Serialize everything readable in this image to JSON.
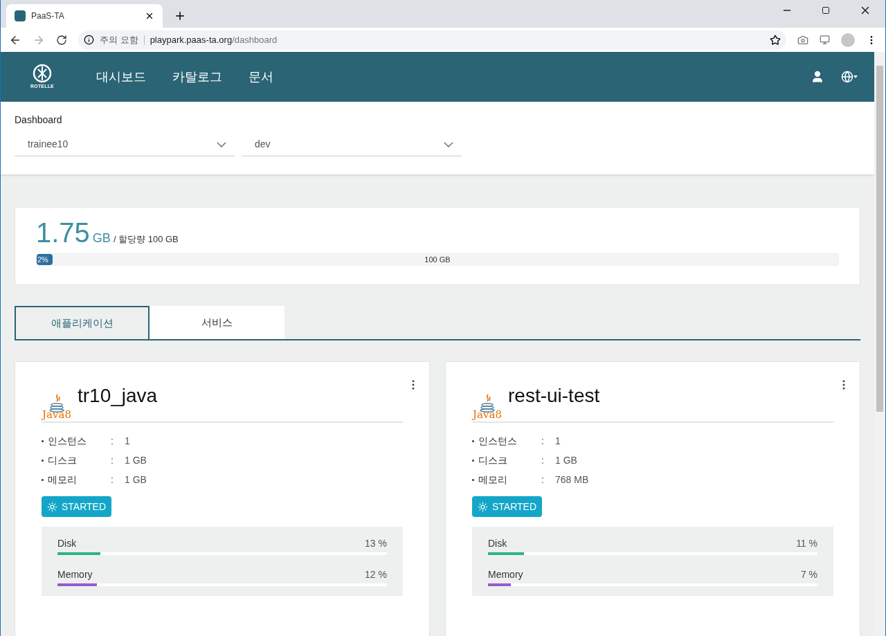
{
  "browser": {
    "tab_title": "PaaS-TA",
    "security_label": "주의 요함",
    "url_host": "playpark.paas-ta.org",
    "url_path": "/dashboard"
  },
  "header": {
    "logo_text": "ROTELLE",
    "nav": [
      {
        "label": "대시보드"
      },
      {
        "label": "카탈로그"
      },
      {
        "label": "문서"
      }
    ]
  },
  "dashboard": {
    "title": "Dashboard",
    "selects": [
      {
        "value": "trainee10"
      },
      {
        "value": "dev"
      }
    ]
  },
  "quota": {
    "used": "1.75",
    "unit": "GB",
    "allocation": "/ 할당량 100 GB",
    "level": 0.02,
    "percent": "2%",
    "total": "100 GB"
  },
  "tabs": [
    {
      "label": "애플리케이션",
      "selected": true
    },
    {
      "label": "서비스",
      "selected": false
    }
  ],
  "apps": [
    {
      "runtime": "Java8",
      "name": "tr10_java",
      "details": [
        {
          "label": "인스턴스",
          "separator": ":",
          "value": "1"
        },
        {
          "label": "디스크",
          "separator": ":",
          "value": "1 GB"
        },
        {
          "label": "메모리",
          "separator": ":",
          "value": "1 GB"
        }
      ],
      "status": "STARTED",
      "usage": [
        {
          "kind": "disk",
          "label": "Disk",
          "reading": "13 %",
          "level": 0.13
        },
        {
          "kind": "memory",
          "label": "Memory",
          "reading": "12 %",
          "level": 0.12
        }
      ]
    },
    {
      "runtime": "Java8",
      "name": "rest-ui-test",
      "details": [
        {
          "label": "인스턴스",
          "separator": ":",
          "value": "1"
        },
        {
          "label": "디스크",
          "separator": ":",
          "value": "1 GB"
        },
        {
          "label": "메모리",
          "separator": ":",
          "value": "768 MB"
        }
      ],
      "status": "STARTED",
      "usage": [
        {
          "kind": "disk",
          "label": "Disk",
          "reading": "11 %",
          "level": 0.11
        },
        {
          "kind": "memory",
          "label": "Memory",
          "reading": "7 %",
          "level": 0.07
        }
      ]
    }
  ]
}
